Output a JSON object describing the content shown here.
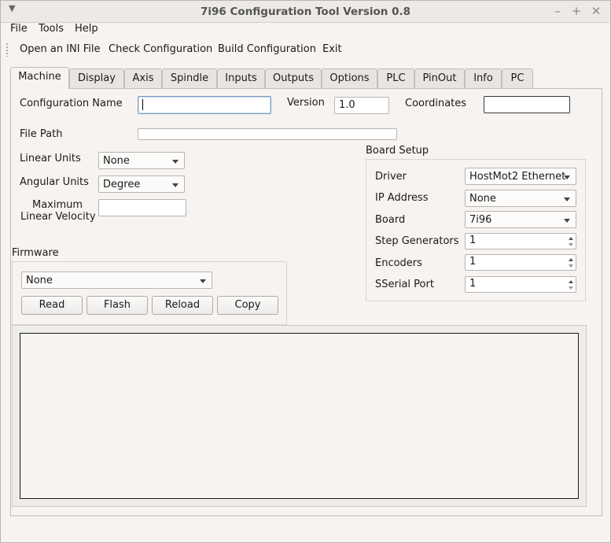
{
  "window": {
    "title": "7i96 Configuration Tool Version 0.8"
  },
  "menubar": [
    "File",
    "Tools",
    "Help"
  ],
  "toolbar": [
    "Open an INI File",
    "Check Configuration",
    "Build Configuration",
    "Exit"
  ],
  "tabs": [
    "Machine",
    "Display",
    "Axis",
    "Spindle",
    "Inputs",
    "Outputs",
    "Options",
    "PLC",
    "PinOut",
    "Info",
    "PC"
  ],
  "active_tab": "Machine",
  "machine": {
    "config_name_label": "Configuration Name",
    "config_name_value": "",
    "version_label": "Version",
    "version_value": "1.0",
    "coordinates_label": "Coordinates",
    "coordinates_value": "",
    "file_path_label": "File Path",
    "file_path_value": "",
    "linear_units_label": "Linear Units",
    "linear_units_value": "None",
    "angular_units_label": "Angular Units",
    "angular_units_value": "Degree",
    "max_linear_velocity_label_1": "Maximum",
    "max_linear_velocity_label_2": "Linear Velocity",
    "max_linear_velocity_value": ""
  },
  "firmware": {
    "label": "Firmware",
    "selected": "None",
    "buttons": [
      "Read",
      "Flash",
      "Reload",
      "Copy"
    ]
  },
  "board_setup": {
    "label": "Board Setup",
    "driver_label": "Driver",
    "driver_value": "HostMot2 Ethernet",
    "ip_label": "IP Address",
    "ip_value": "None",
    "board_label": "Board",
    "board_value": "7i96",
    "step_gen_label": "Step Generators",
    "step_gen_value": "1",
    "encoders_label": "Encoders",
    "encoders_value": "1",
    "sserial_label": "SSerial Port",
    "sserial_value": "1"
  },
  "icons": {
    "window_menu": "chevron-down-icon",
    "minimize": "minimize-icon",
    "maximize": "maximize-icon",
    "close": "close-icon"
  }
}
